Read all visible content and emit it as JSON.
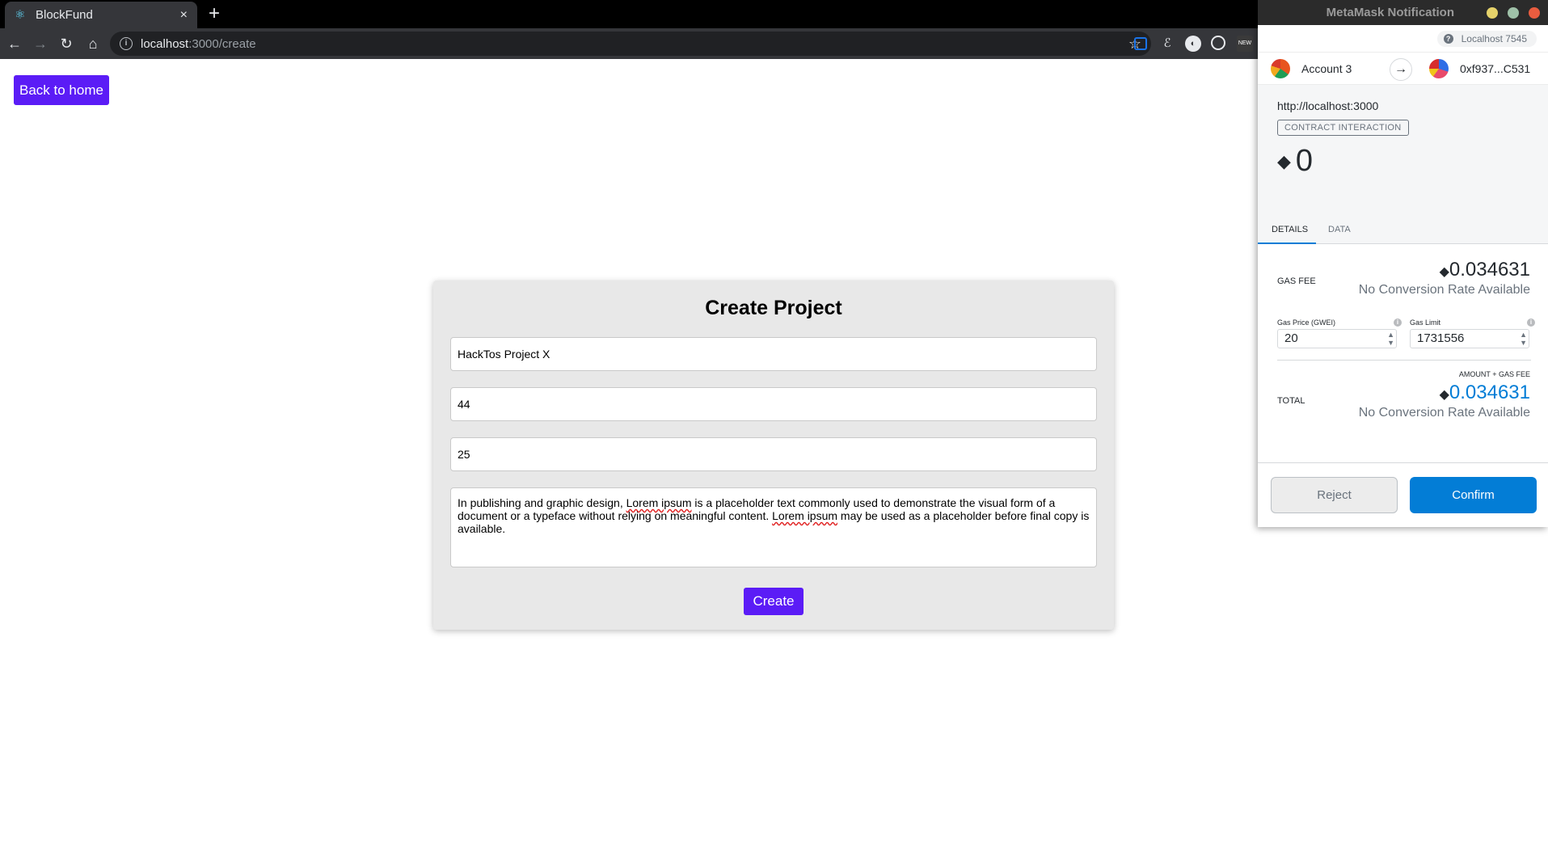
{
  "browser": {
    "tab_title": "BlockFund",
    "tab_close": "×",
    "new_tab": "+",
    "url_host": "localhost",
    "url_path": ":3000/create"
  },
  "page": {
    "back_label": "Back to home",
    "form_title": "Create Project",
    "project_name": "HackTos Project X",
    "field_2": "44",
    "field_3": "25",
    "description_parts": [
      "In publishing and graphic design, ",
      "Lorem ipsum",
      " is a placeholder text commonly used to demonstrate the visual form of a document or a typeface without relying on meaningful content. ",
      "Lorem ipsum",
      " may be used as a placeholder before final copy is available."
    ],
    "create_label": "Create"
  },
  "metamask": {
    "window_title": "MetaMask Notification",
    "network": "Localhost 7545",
    "from_account": "Account 3",
    "to_address": "0xf937...C531",
    "origin": "http://localhost:3000",
    "badge": "CONTRACT INTERACTION",
    "amount": "0",
    "tabs": [
      "DETAILS",
      "DATA"
    ],
    "gas_fee_label": "GAS FEE",
    "gas_fee": "0.034631",
    "no_conversion": "No Conversion Rate Available",
    "gas_price_label": "Gas Price (GWEI)",
    "gas_price": "20",
    "gas_limit_label": "Gas Limit",
    "gas_limit": "1731556",
    "amount_plus_gas": "AMOUNT + GAS FEE",
    "total_label": "TOTAL",
    "total": "0.034631",
    "reject_label": "Reject",
    "confirm_label": "Confirm"
  },
  "colors": {
    "accent": "#5b1cf6",
    "mm_blue": "#037dd6"
  }
}
